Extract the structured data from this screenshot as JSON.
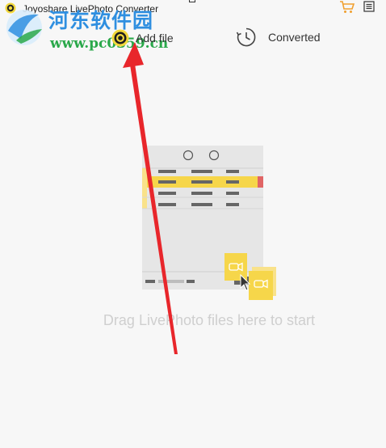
{
  "window": {
    "title": "Joyoshare LivePhoto Converter"
  },
  "watermark": {
    "title": "河东软件园",
    "url": "www.pc0359.cn"
  },
  "toolbar": {
    "add_file_label": "Add file",
    "converted_label": "Converted"
  },
  "drop_zone": {
    "hint": "Drag LivePhoto files here to start"
  },
  "colors": {
    "accent_yellow": "#f6d64a",
    "arrow_red": "#e8262b",
    "watermark_blue": "#2f8fe0",
    "watermark_green": "#2aa84a"
  },
  "icons": [
    "app-logo-icon",
    "shopping-cart-icon",
    "menu-icon",
    "add-file-icon",
    "clock-icon",
    "video-camera-icon",
    "mouse-cursor-icon"
  ]
}
